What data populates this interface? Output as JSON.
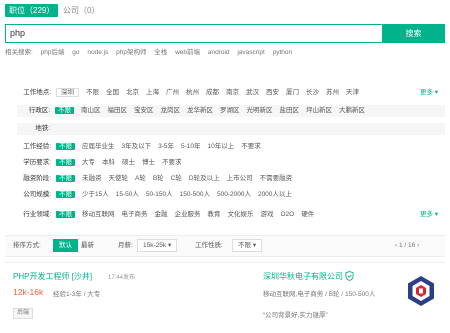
{
  "tabs": {
    "active": "职位（229）",
    "other": "公司（0）"
  },
  "search": {
    "value": "php",
    "button": "搜索"
  },
  "related": {
    "label": "相关搜索:",
    "items": [
      "php后端",
      "go",
      "node.js",
      "php架构师",
      "全栈",
      "web前端",
      "android",
      "javascript",
      "python"
    ]
  },
  "filters": [
    {
      "label": "工作地点:",
      "options": [
        "深圳",
        "不限",
        "全国",
        "北京",
        "上海",
        "广州",
        "杭州",
        "成都",
        "南京",
        "武汉",
        "西安",
        "厦门",
        "长沙",
        "苏州",
        "天津"
      ],
      "more": "更多"
    },
    {
      "label": "行政区:",
      "options": [
        "不限",
        "南山区",
        "福田区",
        "宝安区",
        "龙岗区",
        "龙华新区",
        "罗湖区",
        "光明新区",
        "盐田区",
        "坪山新区",
        "大鹏新区"
      ],
      "sub": true
    },
    {
      "label": "地铁:",
      "options": [],
      "sub": true
    },
    {
      "label": "工作经验:",
      "options": [
        "不限",
        "应届毕业生",
        "3年及以下",
        "3-5年",
        "5-10年",
        "10年以上",
        "不要求"
      ]
    },
    {
      "label": "学历要求:",
      "options": [
        "不限",
        "大专",
        "本科",
        "硕士",
        "博士",
        "不要求"
      ]
    },
    {
      "label": "融资阶段:",
      "options": [
        "不限",
        "未融资",
        "天使轮",
        "A轮",
        "B轮",
        "C轮",
        "D轮及以上",
        "上市公司",
        "不需要融资"
      ]
    },
    {
      "label": "公司规模:",
      "options": [
        "不限",
        "少于15人",
        "15-50人",
        "50-150人",
        "150-500人",
        "500-2000人",
        "2000人以上"
      ]
    },
    {
      "label": "行业领域:",
      "options": [
        "不限",
        "移动互联网",
        "电子商务",
        "金融",
        "企业服务",
        "教育",
        "文化娱乐",
        "游戏",
        "O2O",
        "硬件"
      ],
      "more": "更多"
    }
  ],
  "sort": {
    "label": "排序方式:",
    "default": "默认",
    "newest": "最新",
    "salary_label": "月薪:",
    "salary_value": "15k-25k",
    "nature_label": "工作性质:",
    "nature_value": "不限",
    "pager": "1 / 16"
  },
  "job": {
    "title": "PHP开发工程师 [沙井]",
    "time": "17:44发布",
    "salary": "12k-16k",
    "requirements": "经验1-3年 / 大专",
    "tag": "后端",
    "company": "深圳华秋电子有限公司",
    "company_info": "移动互联网,电子商务 / B轮 / 150-500人",
    "slogan": "“公司背景好,实力雄厚”"
  },
  "colors": {
    "accent": "#00b38a",
    "salary": "#fd5f39"
  }
}
